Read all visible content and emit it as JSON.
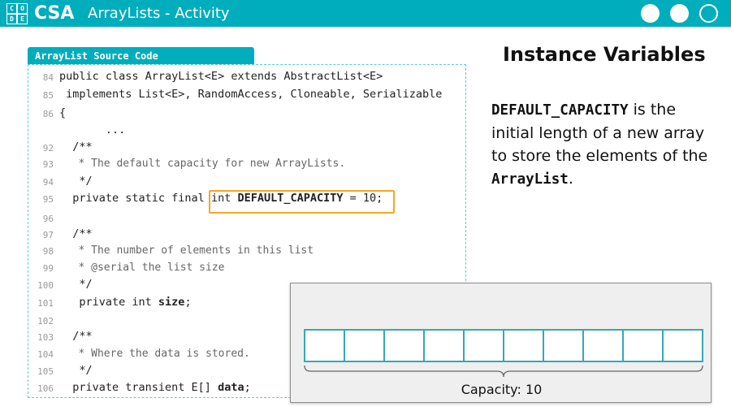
{
  "header": {
    "logo_letters": [
      "C",
      "O",
      "D",
      "E"
    ],
    "course": "CSA",
    "title": "ArrayLists - Activity",
    "bg_color": "#00adbc"
  },
  "code_panel": {
    "tab_label": "ArrayList Source Code",
    "lines": [
      {
        "num": "84",
        "text": "public class ArrayList<E> extends AbstractList<E>"
      },
      {
        "num": "85",
        "text": " implements List<E>, RandomAccess, Cloneable, Serializable"
      },
      {
        "num": "86",
        "text": "{"
      },
      {
        "num": "",
        "text": "       ..."
      },
      {
        "num": "92",
        "text": "  /**"
      },
      {
        "num": "93",
        "text": "   * The default capacity for new ArrayLists."
      },
      {
        "num": "94",
        "text": "   */"
      },
      {
        "num": "95",
        "pre": "  private static final ",
        "hl_pre": "int ",
        "hl_bold": "DEFAULT_CAPACITY",
        "hl_post": " = 10;"
      },
      {
        "num": "96",
        "text": ""
      },
      {
        "num": "97",
        "text": "  /**"
      },
      {
        "num": "98",
        "text": "   * The number of elements in this list"
      },
      {
        "num": "99",
        "text": "   * @serial the list size"
      },
      {
        "num": "100",
        "text": "   */"
      },
      {
        "num": "101",
        "pre": "   private int ",
        "bold": "size",
        "post": ";"
      },
      {
        "num": "102",
        "text": ""
      },
      {
        "num": "103",
        "text": "  /**"
      },
      {
        "num": "104",
        "text": "   * Where the data is stored."
      },
      {
        "num": "105",
        "text": "   */"
      },
      {
        "num": "106",
        "pre": "  private transient E[] ",
        "bold": "data",
        "post": ";"
      }
    ]
  },
  "info": {
    "title": "Instance Variables",
    "desc_term": "DEFAULT_CAPACITY",
    "desc_text1": " is the initial length of a new array to store the elements of the ",
    "desc_term2": "ArrayList",
    "desc_text2": "."
  },
  "diagram": {
    "cell_count": 10,
    "capacity_label": "Capacity: 10"
  }
}
